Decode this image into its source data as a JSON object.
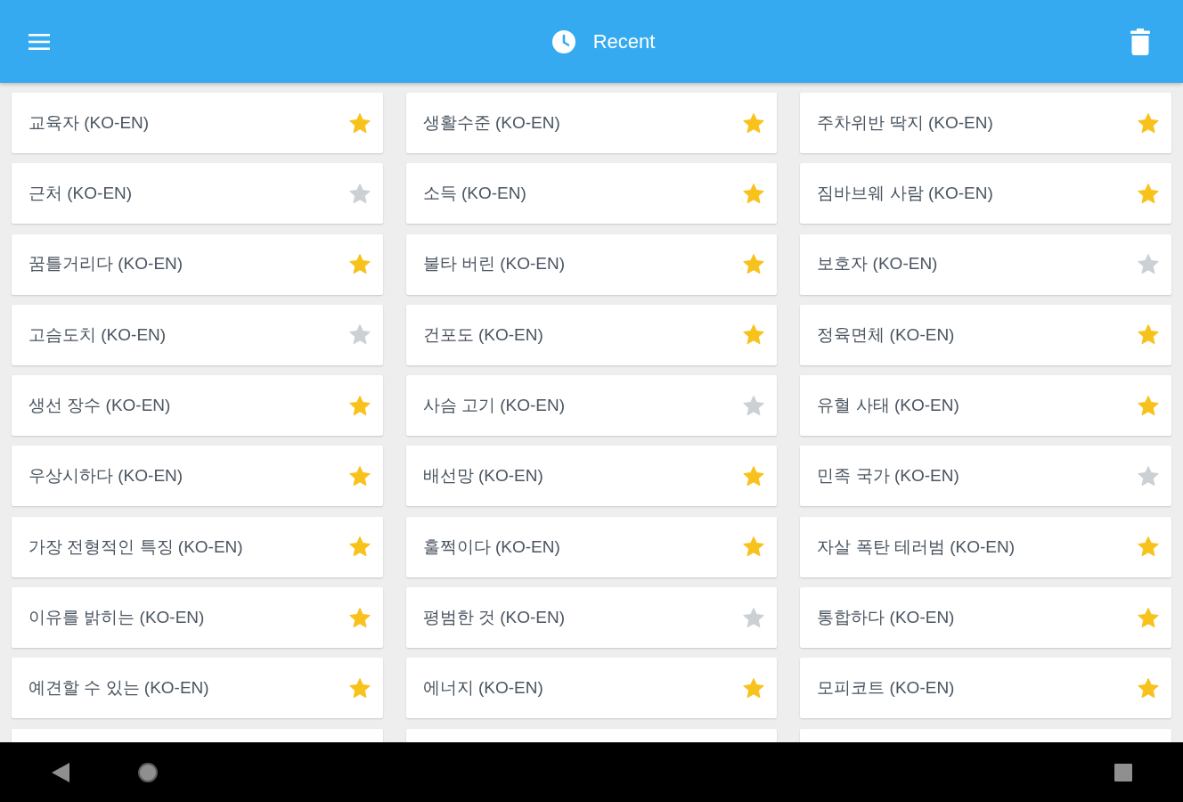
{
  "app_bar": {
    "title": "Recent"
  },
  "entries": [
    {
      "term": "교육자 (KO-EN)",
      "starred": true
    },
    {
      "term": "생활수준 (KO-EN)",
      "starred": true
    },
    {
      "term": "주차위반 딱지 (KO-EN)",
      "starred": true
    },
    {
      "term": "근처 (KO-EN)",
      "starred": false
    },
    {
      "term": "소득 (KO-EN)",
      "starred": true
    },
    {
      "term": "짐바브웨 사람 (KO-EN)",
      "starred": true
    },
    {
      "term": "꿈틀거리다 (KO-EN)",
      "starred": true
    },
    {
      "term": "불타 버린 (KO-EN)",
      "starred": true
    },
    {
      "term": "보호자 (KO-EN)",
      "starred": false
    },
    {
      "term": "고슴도치 (KO-EN)",
      "starred": false
    },
    {
      "term": "건포도 (KO-EN)",
      "starred": true
    },
    {
      "term": "정육면체 (KO-EN)",
      "starred": true
    },
    {
      "term": "생선 장수 (KO-EN)",
      "starred": true
    },
    {
      "term": "사슴 고기 (KO-EN)",
      "starred": false
    },
    {
      "term": "유혈 사태 (KO-EN)",
      "starred": true
    },
    {
      "term": "우상시하다 (KO-EN)",
      "starred": true
    },
    {
      "term": "배선망 (KO-EN)",
      "starred": true
    },
    {
      "term": "민족 국가 (KO-EN)",
      "starred": false
    },
    {
      "term": "가장 전형적인 특징 (KO-EN)",
      "starred": true
    },
    {
      "term": "훌쩍이다 (KO-EN)",
      "starred": true
    },
    {
      "term": "자살 폭탄 테러범 (KO-EN)",
      "starred": true
    },
    {
      "term": "이유를 밝히는 (KO-EN)",
      "starred": true
    },
    {
      "term": "평범한 것 (KO-EN)",
      "starred": false
    },
    {
      "term": "통합하다 (KO-EN)",
      "starred": true
    },
    {
      "term": "예견할 수 있는 (KO-EN)",
      "starred": true
    },
    {
      "term": "에너지 (KO-EN)",
      "starred": true
    },
    {
      "term": "모피코트 (KO-EN)",
      "starred": true
    }
  ]
}
